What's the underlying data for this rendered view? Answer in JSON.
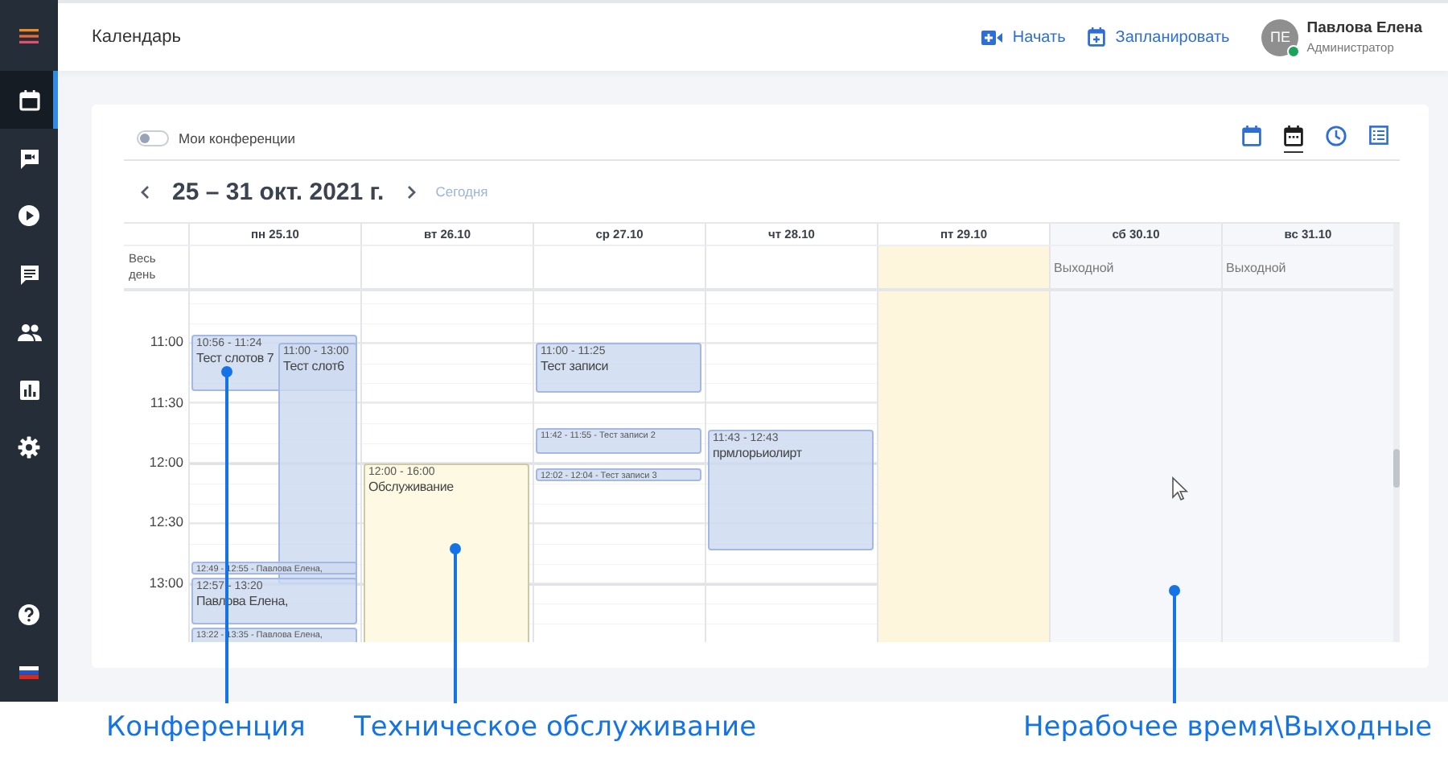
{
  "sidebar": {
    "items": [
      {
        "kind": "calendar",
        "selected": true
      },
      {
        "kind": "video-chat",
        "selected": false
      },
      {
        "kind": "play",
        "selected": false
      },
      {
        "kind": "chat",
        "selected": false
      },
      {
        "kind": "people",
        "selected": false
      },
      {
        "kind": "chart",
        "selected": false
      },
      {
        "kind": "settings",
        "selected": false
      }
    ],
    "bottom_items": [
      {
        "kind": "help"
      },
      {
        "kind": "language"
      }
    ]
  },
  "header": {
    "title": "Календарь",
    "actions": [
      {
        "kind": "video",
        "label": "Начать"
      },
      {
        "kind": "schedule",
        "label": "Запланировать"
      }
    ],
    "user": {
      "initials": "ПЕ",
      "name": "Павлова Елена",
      "role": "Администратор",
      "online": true
    }
  },
  "toolbar": {
    "toggle": {
      "label": "Мои конференции",
      "on": false
    },
    "views": [
      {
        "kind": "month",
        "selected": false
      },
      {
        "kind": "week",
        "selected": true
      },
      {
        "kind": "day",
        "selected": false
      },
      {
        "kind": "list",
        "selected": false
      }
    ],
    "range": "25 – 31 окт. 2021 г.",
    "today": "Сегодня"
  },
  "calendar": {
    "all_day_label": "Весь день",
    "times": [
      "11:00",
      "11:30",
      "12:00",
      "12:30",
      "13:00"
    ],
    "days": [
      {
        "label": "пн 25.10",
        "kind": "workday",
        "events": [
          {
            "kind": "conference",
            "time": "10:56 - 11:24",
            "title": "Тест слотов 7",
            "indented": false
          },
          {
            "kind": "conference",
            "time": "11:00 - 13:00",
            "title": "Тест слот6",
            "indented": true
          },
          {
            "kind": "conference",
            "text": "12:49 - 12:55 - Павлова Елена,",
            "indented": false
          },
          {
            "kind": "conference",
            "time": "12:57 - 13:20",
            "title": "Павлова Елена,",
            "indented": false
          },
          {
            "kind": "conference",
            "text": "13:22 - 13:35 - Павлова Елена,",
            "indented": false
          }
        ]
      },
      {
        "label": "вт 26.10",
        "kind": "workday",
        "events": [
          {
            "kind": "maintenance",
            "time": "12:00 - 16:00",
            "title": "Обслуживание",
            "indented": false
          }
        ]
      },
      {
        "label": "ср 27.10",
        "kind": "workday",
        "events": [
          {
            "kind": "conference",
            "time": "11:00 - 11:25",
            "title": "Тест записи",
            "indented": false
          },
          {
            "kind": "conference",
            "text": "11:42 - 11:55 - Тест записи 2",
            "indented": false
          },
          {
            "kind": "conference",
            "text": "12:02 - 12:04 - Тест записи 3",
            "indented": false
          }
        ]
      },
      {
        "label": "чт 28.10",
        "kind": "workday",
        "events": [
          {
            "kind": "conference",
            "time": "11:43 - 12:43",
            "title": "прмлорьиолирт",
            "indented": false
          }
        ]
      },
      {
        "label": "пт 29.10",
        "kind": "maintenance"
      },
      {
        "label": "сб 30.10",
        "kind": "dayoff",
        "all_day": "Выходной"
      },
      {
        "label": "вс 31.10",
        "kind": "dayoff",
        "all_day": "Выходной"
      }
    ]
  },
  "annotations": [
    {
      "label": "Конференция"
    },
    {
      "label": "Техническое обслуживание"
    },
    {
      "label": "Нерабочее время\\Выходные"
    }
  ]
}
